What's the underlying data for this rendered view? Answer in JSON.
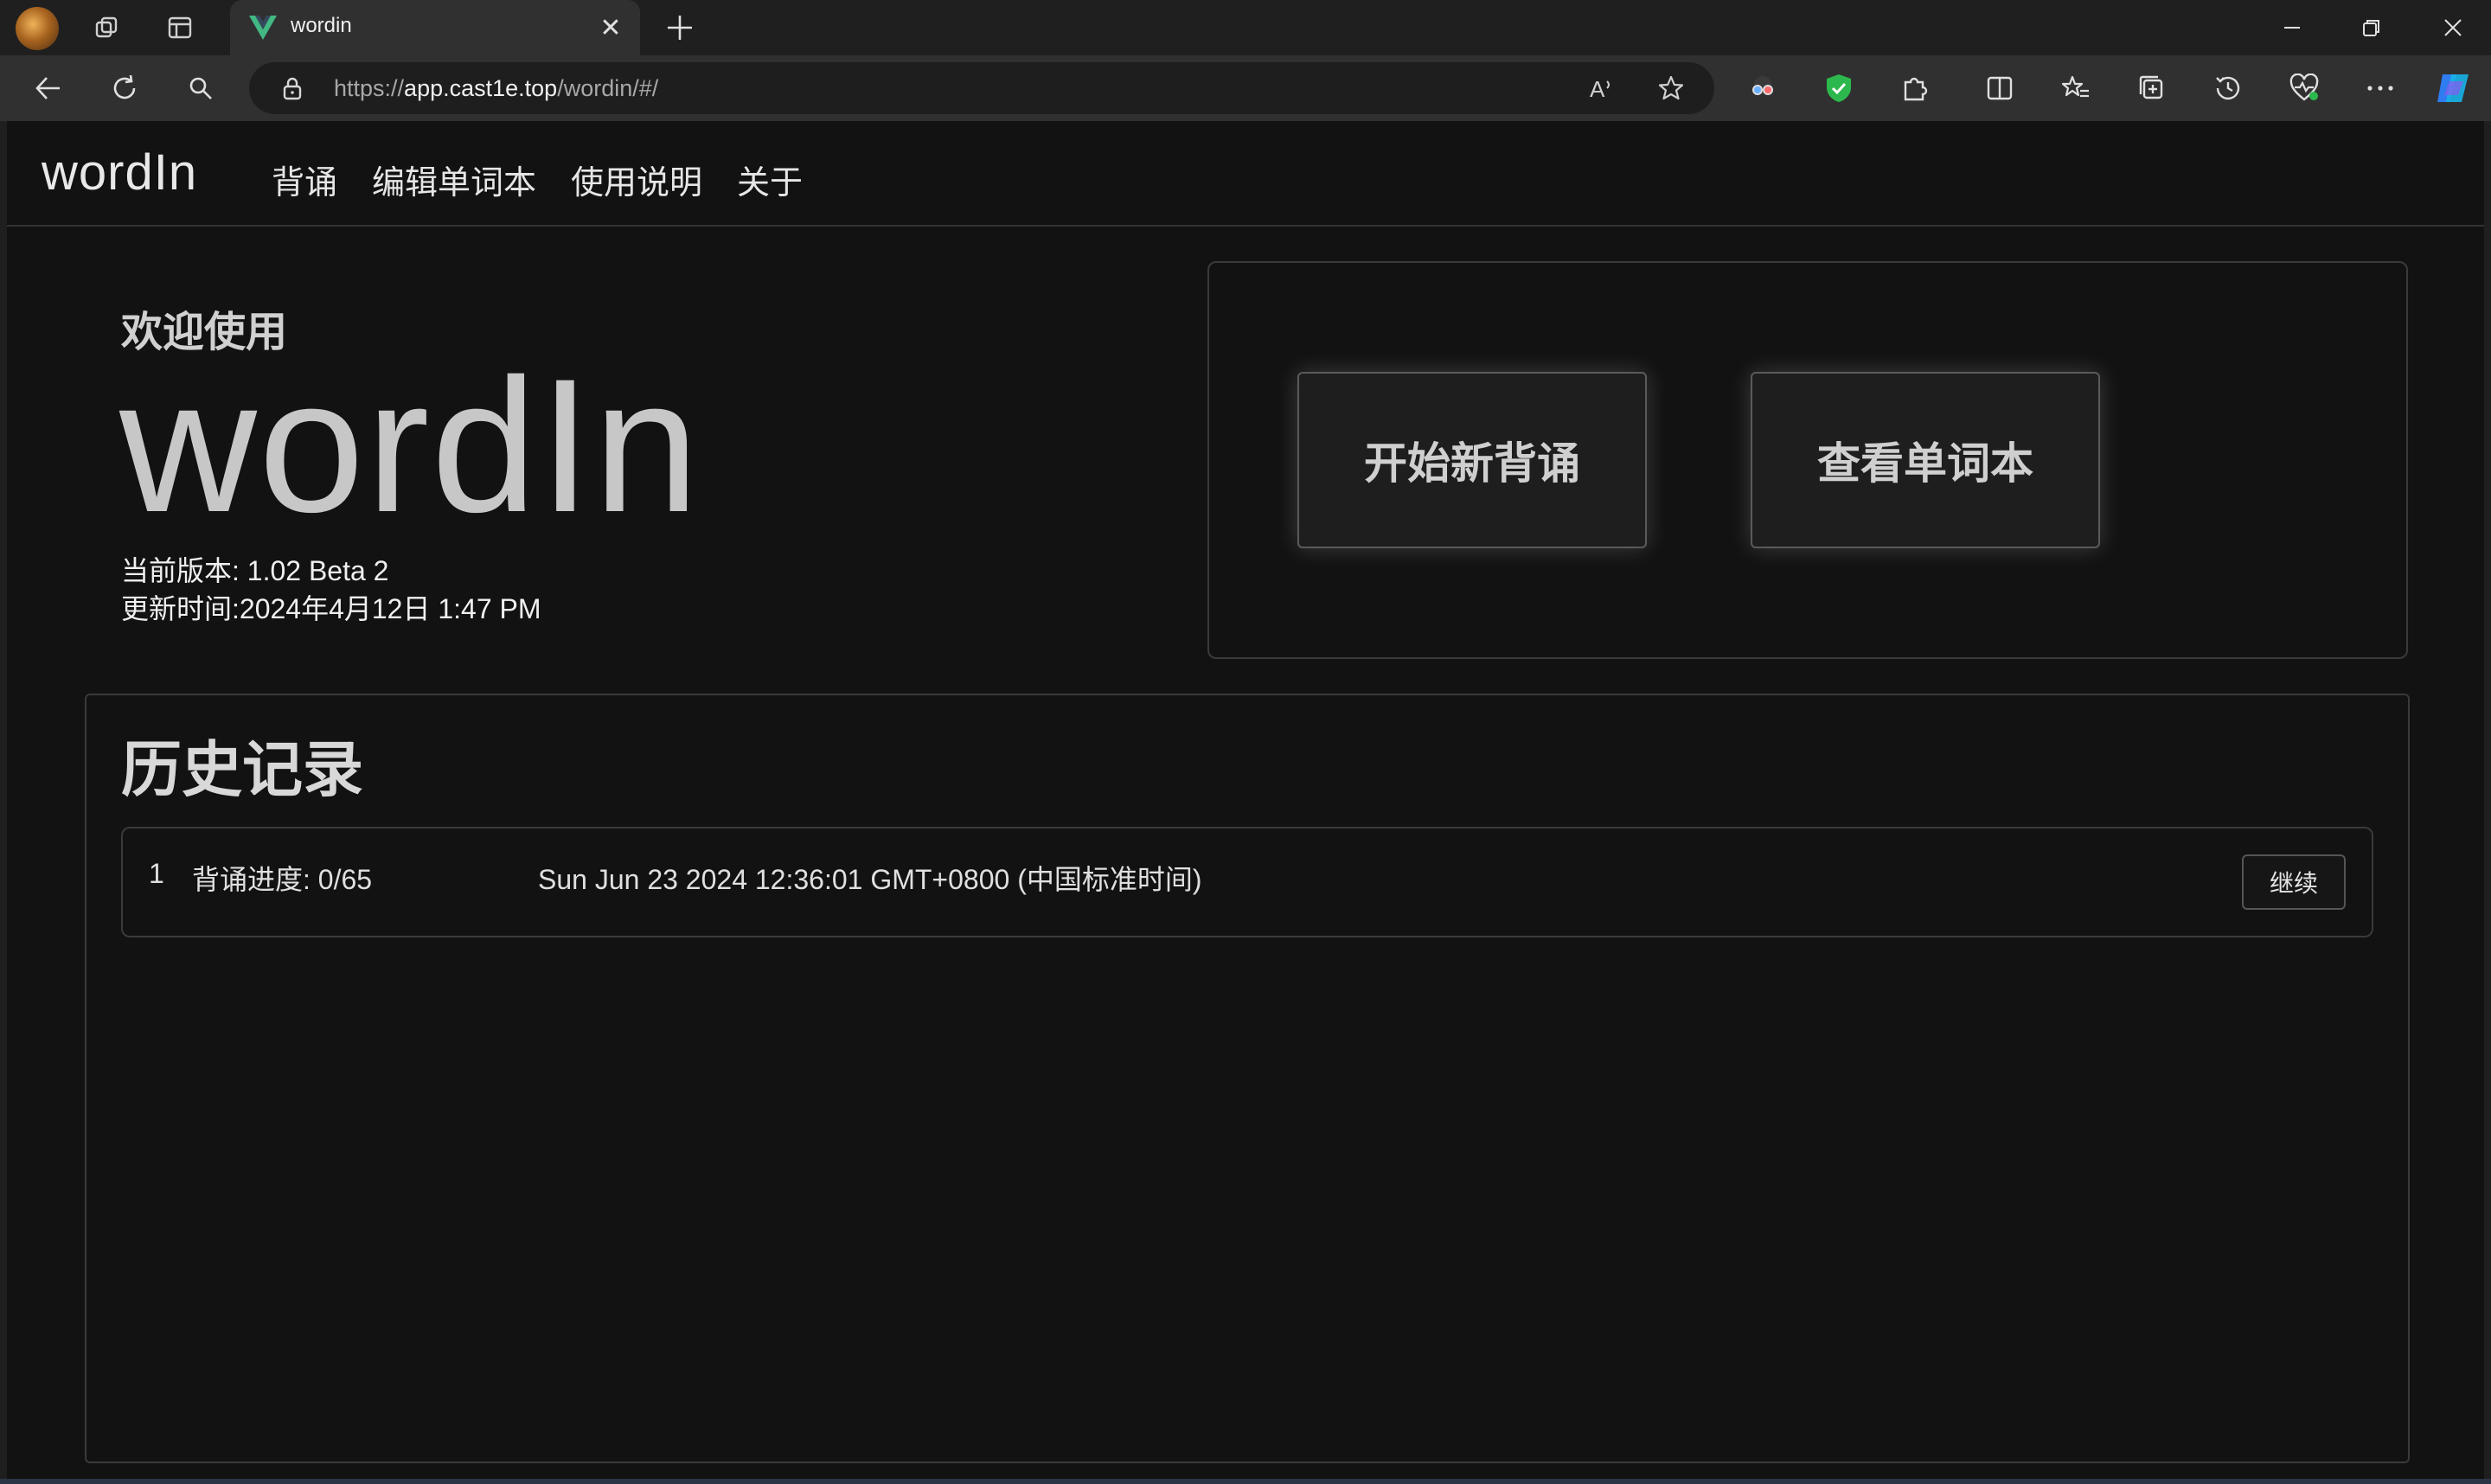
{
  "browser": {
    "tab_title": "wordin",
    "url_prefix": "https://",
    "url_host": "app.cast1e.top",
    "url_path": "/wordin/#/",
    "icons": [
      "profile-avatar",
      "workspaces-icon",
      "tab-actions-icon",
      "new-tab-icon",
      "back-icon",
      "refresh-icon",
      "search-icon",
      "lock-icon",
      "read-aloud-icon",
      "favorite-star-icon",
      "extension-glasses-icon",
      "extension-shield-icon",
      "extensions-puzzle-icon",
      "split-screen-icon",
      "favorites-icon",
      "collections-icon",
      "history-icon",
      "browser-essentials-icon",
      "more-icon",
      "copilot-icon",
      "minimize-icon",
      "restore-icon",
      "close-icon"
    ]
  },
  "app": {
    "brand": "wordIn",
    "nav": [
      "背诵",
      "编辑单词本",
      "使用说明",
      "关于"
    ]
  },
  "hero": {
    "welcome_small": "欢迎使用",
    "welcome_big": "wordIn",
    "version_line": "当前版本: 1.02 Beta 2",
    "update_line": "更新时间:2024年4月12日 1:47 PM"
  },
  "actions": {
    "start_label": "开始新背诵",
    "view_label": "查看单词本"
  },
  "history": {
    "title": "历史记录",
    "rows": [
      {
        "index": "1",
        "progress": "背诵进度: 0/65",
        "time": "Sun Jun 23 2024 12:36:01 GMT+0800 (中国标准时间)",
        "action": "继续"
      }
    ]
  },
  "colors": {
    "page_bg": "#121212",
    "chrome_bg": "#1f1f1f",
    "shield_green": "#2db84d",
    "tab_logo_green": "#42b883"
  }
}
